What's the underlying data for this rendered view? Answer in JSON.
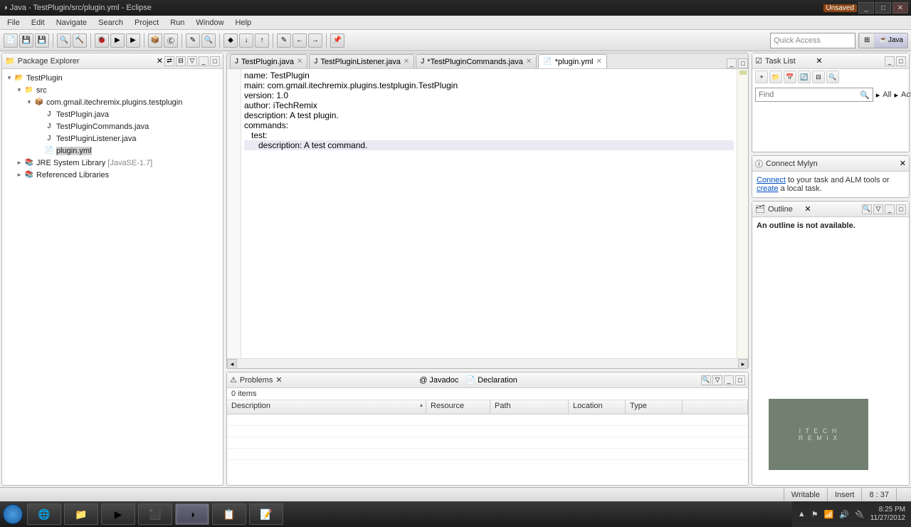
{
  "window": {
    "title": "Java - TestPlugin/src/plugin.yml - Eclipse",
    "unsaved_badge": "Unsaved"
  },
  "menu": [
    "File",
    "Edit",
    "Navigate",
    "Search",
    "Project",
    "Run",
    "Window",
    "Help"
  ],
  "quickaccess_placeholder": "Quick Access",
  "perspective": {
    "java": "Java"
  },
  "package_explorer": {
    "title": "Package Explorer",
    "tree": {
      "project": "TestPlugin",
      "src": "src",
      "pkg": "com.gmail.itechremix.plugins.testplugin",
      "files": [
        "TestPlugin.java",
        "TestPluginCommands.java",
        "TestPluginListener.java",
        "plugin.yml"
      ],
      "jre": "JRE System Library",
      "jre_env": "[JavaSE-1.7]",
      "reflibs": "Referenced Libraries"
    }
  },
  "editor": {
    "tabs": [
      {
        "label": "TestPlugin.java",
        "active": false,
        "dirty": false,
        "icon": "J"
      },
      {
        "label": "TestPluginListener.java",
        "active": false,
        "dirty": false,
        "icon": "J"
      },
      {
        "label": "*TestPluginCommands.java",
        "active": false,
        "dirty": true,
        "icon": "J"
      },
      {
        "label": "*plugin.yml",
        "active": true,
        "dirty": true,
        "icon": "Y"
      }
    ],
    "lines": [
      "name: TestPlugin",
      "main: com.gmail.itechremix.plugins.testplugin.TestPlugin",
      "version: 1.0",
      "author: iTechRemix",
      "description: A test plugin.",
      "commands:",
      "   test:",
      "      description: A test command."
    ],
    "highlight_line": 7
  },
  "problems": {
    "title": "Problems",
    "other_tabs": [
      "Javadoc",
      "Declaration"
    ],
    "summary": "0 items",
    "columns": [
      "Description",
      "Resource",
      "Path",
      "Location",
      "Type"
    ]
  },
  "tasklist": {
    "title": "Task List",
    "find_label": "Find",
    "all_label": "All",
    "activate_label": "Activate..."
  },
  "mylyn": {
    "title": "Connect Mylyn",
    "connect": "Connect",
    "text1": " to your task and ALM tools or ",
    "create": "create",
    "text2": " a local task."
  },
  "outline": {
    "title": "Outline",
    "body": "An outline is not available."
  },
  "statusbar": {
    "writable": "Writable",
    "insert": "Insert",
    "position": "8 : 37"
  },
  "tray": {
    "time": "8:25 PM",
    "date": "11/27/2012"
  },
  "watermark": {
    "l1": "I T E C H",
    "l2": "R E M I X"
  }
}
